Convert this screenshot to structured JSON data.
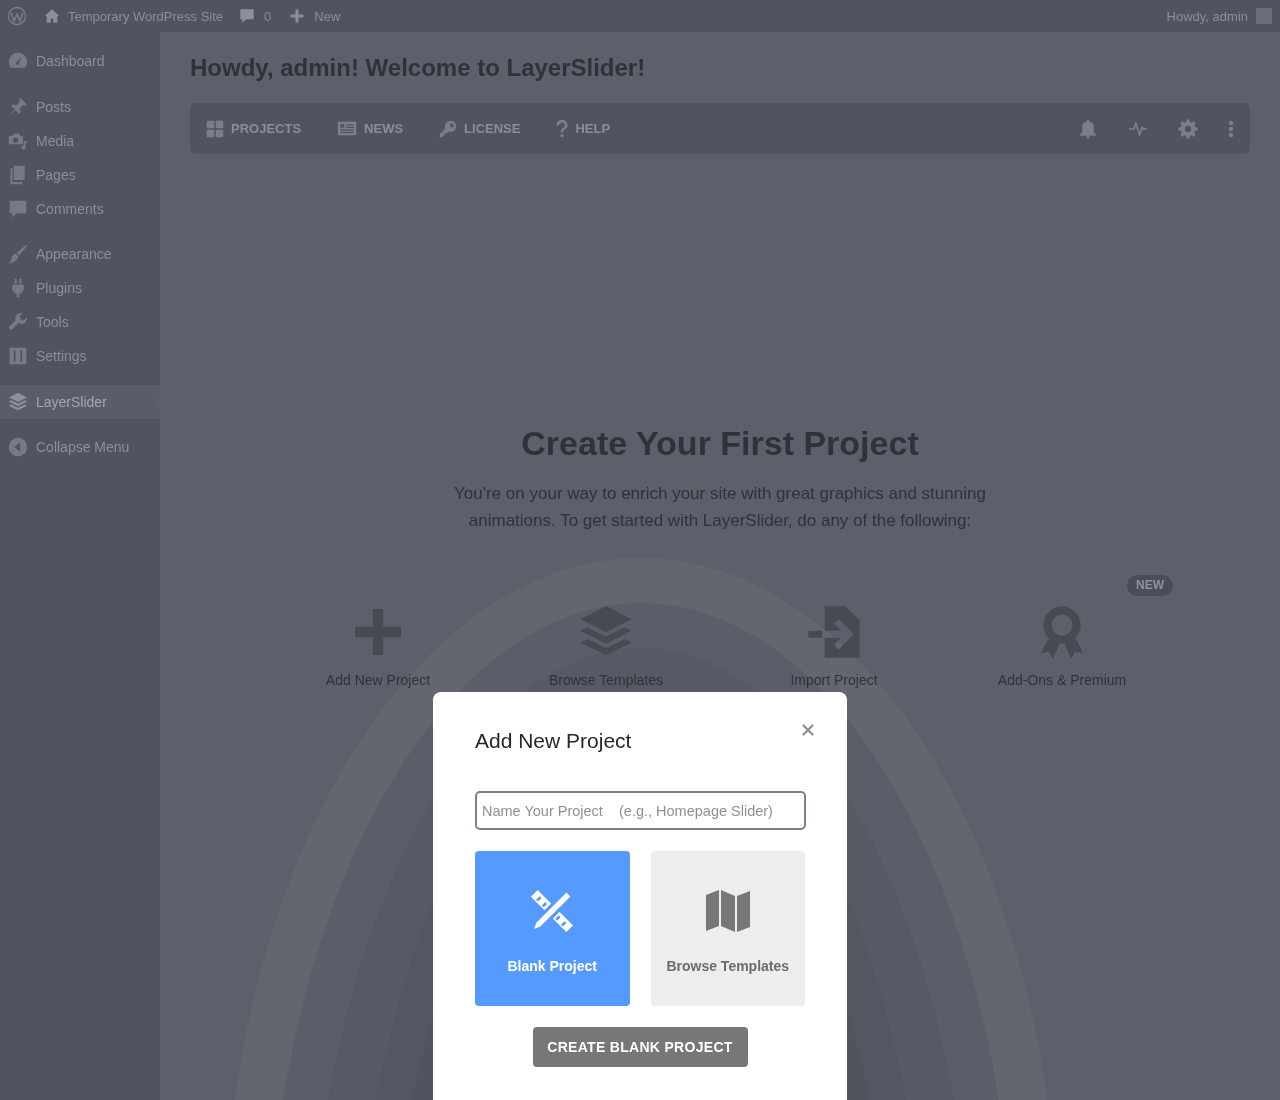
{
  "admin_bar": {
    "site_name": "Temporary WordPress Site",
    "comment_count": "0",
    "new_label": "New",
    "greeting": "Howdy, admin"
  },
  "sidebar": {
    "groups": [
      {
        "items": [
          {
            "label": "Dashboard",
            "selected": false
          }
        ]
      },
      {
        "items": [
          {
            "label": "Posts",
            "selected": false
          },
          {
            "label": "Media",
            "selected": false
          },
          {
            "label": "Pages",
            "selected": false
          },
          {
            "label": "Comments",
            "selected": false
          }
        ]
      },
      {
        "items": [
          {
            "label": "Appearance",
            "selected": false
          },
          {
            "label": "Plugins",
            "selected": false
          },
          {
            "label": "Tools",
            "selected": false
          },
          {
            "label": "Settings",
            "selected": false
          }
        ]
      },
      {
        "items": [
          {
            "label": "LayerSlider",
            "selected": true
          }
        ]
      }
    ],
    "collapse_label": "Collapse Menu"
  },
  "page": {
    "title": "Howdy, admin! Welcome to LayerSlider!",
    "tabs": [
      {
        "label": "PROJECTS"
      },
      {
        "label": "NEWS"
      },
      {
        "label": "LICENSE"
      },
      {
        "label": "HELP"
      }
    ]
  },
  "hero": {
    "title": "Create Your First Project",
    "text": "You're on your way to enrich your site with great graphics and stunning animations. To get started with LayerSlider, do any of the following:",
    "actions": [
      {
        "label": "Add New Project"
      },
      {
        "label": "Browse Templates"
      },
      {
        "label": "Import Project"
      },
      {
        "label": "Add-Ons & Premium",
        "badge": "NEW"
      }
    ]
  },
  "modal": {
    "title": "Add New Project",
    "name_field": {
      "placeholder": "Name Your Project    (e.g., Homepage Slider)"
    },
    "options": [
      {
        "label": "Blank Project",
        "selected": true
      },
      {
        "label": "Browse Templates",
        "selected": false
      }
    ],
    "submit": "CREATE BLANK PROJECT"
  }
}
